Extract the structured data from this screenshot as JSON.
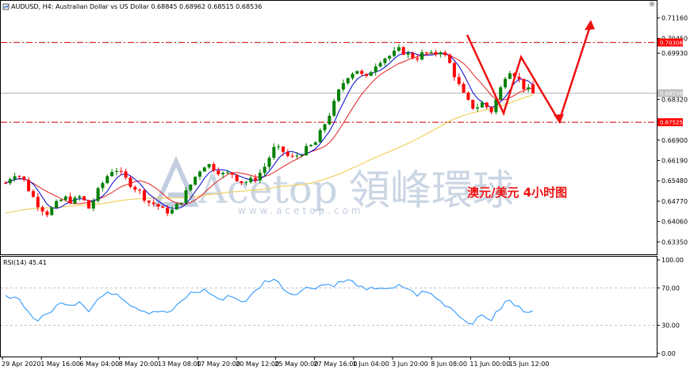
{
  "header": {
    "symbol_info": "AUDUSD, H4:  Australian Dollar vs US Dollar  0.68845 0.68962 0.68515 0.68536"
  },
  "rsi": {
    "label": "RSI(14) 45.41"
  },
  "watermark": {
    "brand": "Acetop",
    "brand_cn": "領峰環球",
    "url": "www.acetop.com"
  },
  "annotation": {
    "title": "澳元/美元 4小时图"
  },
  "price_axis": {
    "ticks": [
      "0.71160",
      "0.70450",
      "0.69930",
      "0.68320",
      "0.66900",
      "0.66190",
      "0.65480",
      "0.64770",
      "0.64060",
      "0.63350"
    ],
    "highlight_labels": [
      {
        "value": "0.70306",
        "color": "#ff0000"
      },
      {
        "value": "0.68536",
        "color": "#c0c0c0"
      },
      {
        "value": "0.67525",
        "color": "#ff0000"
      }
    ]
  },
  "rsi_axis": {
    "ticks": [
      "100.00",
      "70.00",
      "30.00",
      "0.00"
    ]
  },
  "time_axis": {
    "labels": [
      "29 Apr 2020",
      "1 May 16:00",
      "6 May 04:00",
      "8 May 20:00",
      "13 May 08:00",
      "17 May 20:00",
      "20 May 12:00",
      "25 May 00:00",
      "27 May 16:00",
      "1 Jun 04:00",
      "3 Jun 20:00",
      "8 Jun 08:00",
      "11 Jun 00:00",
      "15 Jun 12:00"
    ]
  },
  "colors": {
    "bull": "#008000",
    "bear": "#ff0000",
    "ma_fast": "#0000cc",
    "ma_mid": "#e02020",
    "ma_slow": "#f0d060",
    "rsi_line": "#1e90ff",
    "level_line": "#cc0000",
    "arrow": "#ee1111"
  },
  "chart_data": {
    "type": "candlestick",
    "symbol": "AUDUSD",
    "timeframe": "H4",
    "ohlc_last": {
      "open": 0.68845,
      "high": 0.68962,
      "low": 0.68515,
      "close": 0.68536
    },
    "horizontal_levels": [
      0.70306,
      0.67525
    ],
    "current_price": 0.68536,
    "y_range": [
      0.63,
      0.714
    ],
    "close_path": [
      [
        0,
        0.654
      ],
      [
        6,
        0.6575
      ],
      [
        12,
        0.656
      ],
      [
        18,
        0.6505
      ],
      [
        24,
        0.646
      ],
      [
        30,
        0.6435
      ],
      [
        36,
        0.6465
      ],
      [
        42,
        0.649
      ],
      [
        48,
        0.6475
      ],
      [
        54,
        0.6495
      ],
      [
        60,
        0.645
      ],
      [
        66,
        0.651
      ],
      [
        72,
        0.656
      ],
      [
        78,
        0.6595
      ],
      [
        84,
        0.6565
      ],
      [
        90,
        0.6535
      ],
      [
        96,
        0.651
      ],
      [
        102,
        0.6475
      ],
      [
        108,
        0.6465
      ],
      [
        114,
        0.644
      ],
      [
        120,
        0.6445
      ],
      [
        126,
        0.648
      ],
      [
        132,
        0.653
      ],
      [
        138,
        0.658
      ],
      [
        144,
        0.661
      ],
      [
        150,
        0.659
      ],
      [
        156,
        0.657
      ],
      [
        162,
        0.6575
      ],
      [
        168,
        0.6545
      ],
      [
        174,
        0.6545
      ],
      [
        180,
        0.656
      ],
      [
        186,
        0.66
      ],
      [
        192,
        0.666
      ],
      [
        198,
        0.6655
      ],
      [
        204,
        0.6625
      ],
      [
        210,
        0.664
      ],
      [
        216,
        0.666
      ],
      [
        222,
        0.668
      ],
      [
        228,
        0.674
      ],
      [
        234,
        0.68
      ],
      [
        240,
        0.6875
      ],
      [
        246,
        0.692
      ],
      [
        252,
        0.6935
      ],
      [
        258,
        0.69
      ],
      [
        264,
        0.695
      ],
      [
        270,
        0.6975
      ],
      [
        276,
        0.6985
      ],
      [
        282,
        0.7005
      ],
      [
        288,
        0.699
      ],
      [
        294,
        0.6975
      ],
      [
        300,
        0.6995
      ],
      [
        306,
        0.6985
      ],
      [
        312,
        0.7005
      ],
      [
        318,
        0.696
      ],
      [
        324,
        0.689
      ],
      [
        330,
        0.683
      ],
      [
        336,
        0.68
      ],
      [
        342,
        0.682
      ],
      [
        348,
        0.679
      ],
      [
        354,
        0.686
      ],
      [
        360,
        0.694
      ],
      [
        366,
        0.6915
      ],
      [
        372,
        0.687
      ],
      [
        378,
        0.6854
      ]
    ],
    "rsi_path": [
      [
        0,
        60
      ],
      [
        6,
        62
      ],
      [
        12,
        55
      ],
      [
        18,
        40
      ],
      [
        24,
        35
      ],
      [
        30,
        42
      ],
      [
        36,
        50
      ],
      [
        42,
        55
      ],
      [
        48,
        52
      ],
      [
        54,
        57
      ],
      [
        60,
        45
      ],
      [
        66,
        58
      ],
      [
        72,
        63
      ],
      [
        78,
        66
      ],
      [
        84,
        60
      ],
      [
        90,
        52
      ],
      [
        96,
        48
      ],
      [
        102,
        44
      ],
      [
        108,
        46
      ],
      [
        114,
        43
      ],
      [
        120,
        46
      ],
      [
        126,
        55
      ],
      [
        132,
        64
      ],
      [
        138,
        66
      ],
      [
        144,
        68
      ],
      [
        150,
        60
      ],
      [
        156,
        57
      ],
      [
        162,
        63
      ],
      [
        168,
        55
      ],
      [
        174,
        58
      ],
      [
        180,
        68
      ],
      [
        186,
        77
      ],
      [
        192,
        80
      ],
      [
        198,
        72
      ],
      [
        204,
        63
      ],
      [
        210,
        66
      ],
      [
        216,
        70
      ],
      [
        222,
        71
      ],
      [
        228,
        74
      ],
      [
        234,
        73
      ],
      [
        240,
        76
      ],
      [
        246,
        78
      ],
      [
        252,
        74
      ],
      [
        258,
        66
      ],
      [
        264,
        70
      ],
      [
        270,
        71
      ],
      [
        276,
        67
      ],
      [
        282,
        72
      ],
      [
        288,
        70
      ],
      [
        294,
        62
      ],
      [
        300,
        66
      ],
      [
        306,
        63
      ],
      [
        312,
        55
      ],
      [
        318,
        50
      ],
      [
        324,
        43
      ],
      [
        330,
        33
      ],
      [
        336,
        34
      ],
      [
        342,
        41
      ],
      [
        348,
        36
      ],
      [
        354,
        47
      ],
      [
        360,
        58
      ],
      [
        366,
        50
      ],
      [
        372,
        46
      ],
      [
        378,
        45
      ]
    ],
    "rsi_value": 45.41,
    "rsi_levels": [
      70,
      30
    ],
    "rsi_range": [
      0,
      100
    ],
    "annotation_arrows": "red zigzag projection: down to 0.6755 then up above 0.7116"
  }
}
